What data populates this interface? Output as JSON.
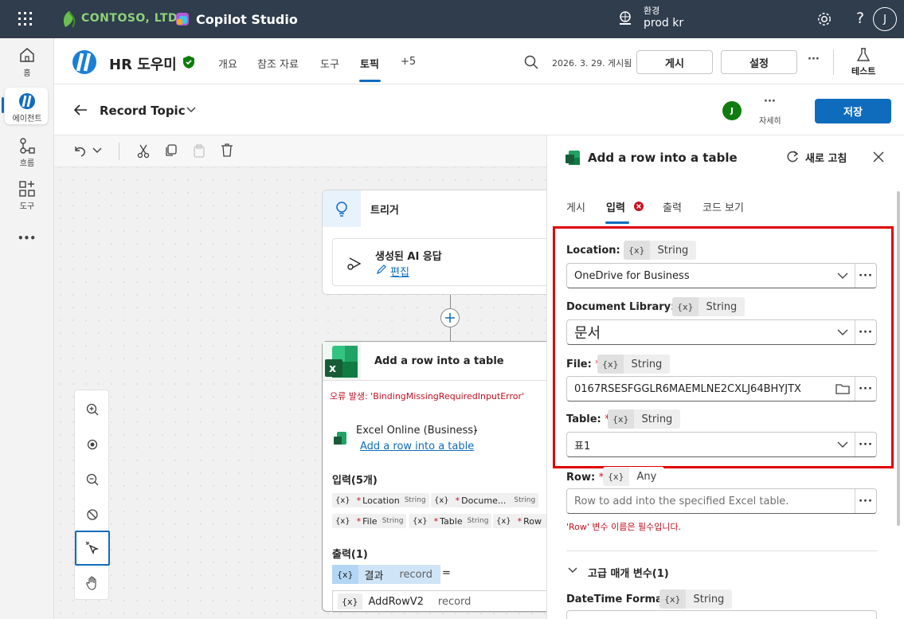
{
  "topbar": {
    "org": "CONTOSO, LTD.",
    "app": "Copilot Studio",
    "env_label": "환경",
    "env_name": "prod kr",
    "help": "?",
    "avatar": "J"
  },
  "rail": {
    "home": "홈",
    "agents": "에이전트",
    "flows": "흐름",
    "tools": "도구",
    "more": "•••"
  },
  "header": {
    "agent_name": "HR 도우미",
    "tabs": [
      "개요",
      "참조 자료",
      "도구",
      "토픽",
      "+5"
    ],
    "active_tab": "토픽",
    "published": "2026. 3. 29. 게시됨",
    "publish": "게시",
    "settings": "설정",
    "more": "···",
    "test": "테스트"
  },
  "subheader": {
    "topic": "Record Topic",
    "avatar": "J",
    "details": "자세히",
    "save": "저장"
  },
  "canvas": {
    "trigger": {
      "title": "트리거",
      "item": "생성된 AI 응답",
      "edit": "편집"
    },
    "action": {
      "title": "Add a row into a table",
      "error": "오류 발생: 'BindingMissingRequiredInputError'",
      "connector": "Excel Online (Business)",
      "dash": "-",
      "link": "Add a row into a table",
      "inputs_title": "입력(5개)",
      "inputs": [
        {
          "name": "Location",
          "type": "String"
        },
        {
          "name": "Docume...",
          "type": "String"
        },
        {
          "name": "File",
          "type": "String"
        },
        {
          "name": "Table",
          "type": "String"
        },
        {
          "name": "Row",
          "type": ""
        }
      ],
      "outputs_title": "출력(1)",
      "out_var": "결과",
      "out_type": "record",
      "eq": "=",
      "out2_var": "AddRowV2",
      "out2_type": "record"
    }
  },
  "panel": {
    "title": "Add a row into a table",
    "refresh": "새로 고침",
    "tabs": [
      "게시",
      "입력",
      "출력",
      "코드 보기"
    ],
    "active_tab": "입력",
    "x": "{x}",
    "star": "*",
    "fields": [
      {
        "label": "Location:",
        "type": "String",
        "value": "OneDrive for Business"
      },
      {
        "label": "Document Library:",
        "type": "String",
        "value": "문서"
      },
      {
        "label": "File:",
        "type": "String",
        "value": "0167RSESFGGLR6MAEMLNE2CXLJ64BHYJTX"
      },
      {
        "label": "Table:",
        "type": "String",
        "value": "표1"
      },
      {
        "label": "Row:",
        "type": "Any",
        "value": "Row to add into the specified Excel table."
      }
    ],
    "row_error": "'Row' 변수 이름은 필수입니다.",
    "advanced": "고급 매개 변수(1)",
    "datetime_label": "DateTime Format:",
    "datetime_type": "String"
  }
}
